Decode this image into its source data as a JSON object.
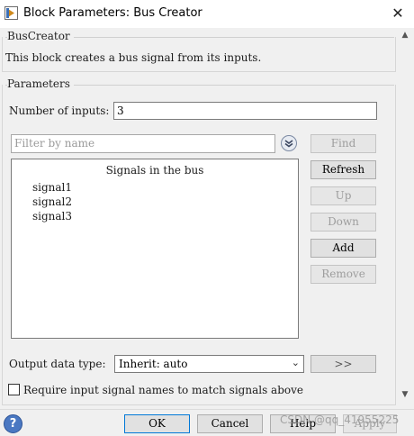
{
  "window": {
    "title": "Block Parameters: Bus Creator",
    "close_glyph": "✕"
  },
  "block_group": {
    "label": "BusCreator",
    "description": "This block creates a bus signal from its inputs."
  },
  "params_group": {
    "label": "Parameters",
    "num_inputs_label": "Number of inputs:",
    "num_inputs_value": "3",
    "filter_placeholder": "Filter by name",
    "list_header": "Signals in the bus",
    "signals": [
      "signal1",
      "signal2",
      "signal3"
    ],
    "buttons": {
      "find": "Find",
      "refresh": "Refresh",
      "up": "Up",
      "down": "Down",
      "add": "Add",
      "remove": "Remove"
    },
    "output_type_label": "Output data type:",
    "output_type_value": "Inherit: auto",
    "output_type_chevron": "⌄",
    "assistant_button": ">>",
    "require_names_label": "Require input signal names to match signals above",
    "require_names_checked": false
  },
  "footer": {
    "help_glyph": "?",
    "ok": "OK",
    "cancel": "Cancel",
    "help": "Help",
    "apply": "Apply"
  },
  "scrollbar": {
    "up_glyph": "▲",
    "down_glyph": "▼"
  },
  "watermark": "CSDN @qq_41955225",
  "colors": {
    "client_bg": "#f0f0f0",
    "help_blue": "#4a78c2",
    "disabled_text": "#9d9d9d"
  }
}
